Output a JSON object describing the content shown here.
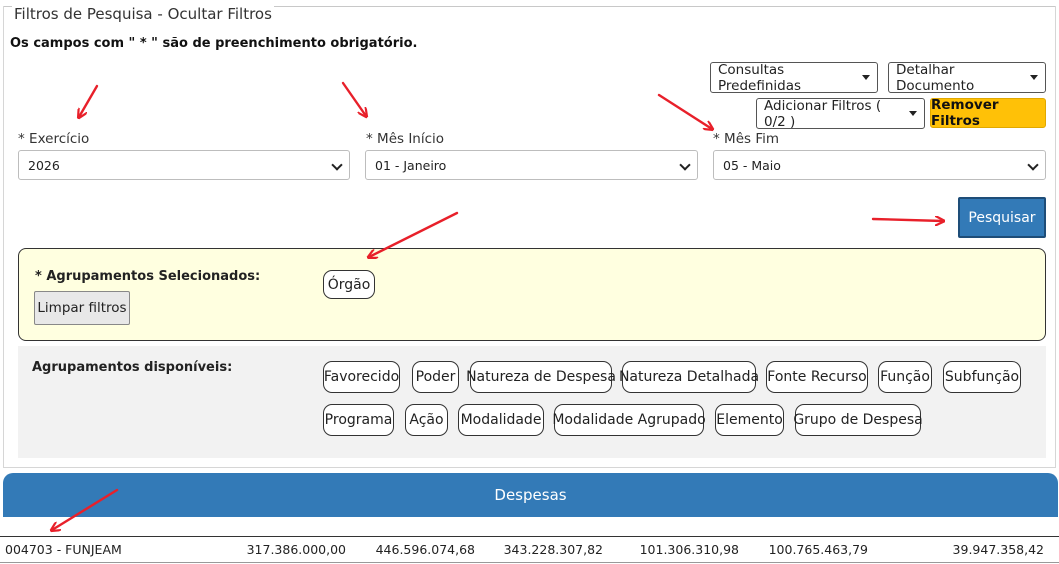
{
  "filters": {
    "legend_title": "Filtros de Pesquisa",
    "legend_sep": " - ",
    "legend_toggle": "Ocultar Filtros",
    "required_note": "Os campos com \" * \" são de preenchimento obrigatório.",
    "buttons": {
      "predefined": "Consultas Predefinidas",
      "detail": "Detalhar Documento",
      "add_filters": "Adicionar Filtros ( 0/2 )",
      "remove_filters": "Remover Filtros",
      "search": "Pesquisar"
    },
    "fields": {
      "exercicio": {
        "label": "* Exercício",
        "value": "2026"
      },
      "mes_inicio": {
        "label": "* Mês Início",
        "value": "01 - Janeiro"
      },
      "mes_fim": {
        "label": "* Mês Fim",
        "value": "05 - Maio"
      }
    }
  },
  "groupings": {
    "selected_title": "* Agrupamentos Selecionados:",
    "clear_button": "Limpar filtros",
    "selected": [
      "Órgão"
    ],
    "available_title": "Agrupamentos disponíveis:",
    "available": [
      "Favorecido",
      "Poder",
      "Natureza de Despesa",
      "Natureza Detalhada",
      "Fonte Recurso",
      "Função",
      "Subfunção",
      "Programa",
      "Ação",
      "Modalidade",
      "Modalidade Agrupado",
      "Elemento",
      "Grupo de Despesa"
    ]
  },
  "table": {
    "title": "Despesas",
    "row": [
      "004703 - FUNJEAM",
      "317.386.000,00",
      "446.596.074,68",
      "343.228.307,82",
      "101.306.310,98",
      "100.765.463,79",
      "39.947.358,42"
    ]
  },
  "colors": {
    "primary": "#337ab7",
    "warning": "#ffc107",
    "selected_bg": "#ffffe0",
    "annotation_arrow": "#e8202a"
  }
}
